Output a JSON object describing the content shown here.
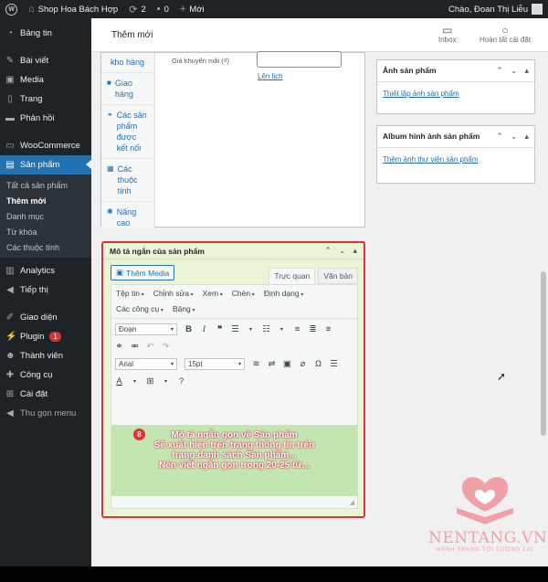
{
  "adminbar": {
    "site_name": "Shop Hoa Bách Hợp",
    "updates_count": "2",
    "comments_count": "0",
    "new_label": "Mới",
    "greeting": "Chào, Đoan Thị Liễu"
  },
  "sidebar": {
    "items": [
      {
        "label": "Bảng tin",
        "icon": "dashboard-icon"
      },
      {
        "label": "Bài viết",
        "icon": "pin-icon"
      },
      {
        "label": "Media",
        "icon": "media-icon"
      },
      {
        "label": "Trang",
        "icon": "page-icon"
      },
      {
        "label": "Phản hồi",
        "icon": "comment-icon"
      },
      {
        "label": "WooCommerce",
        "icon": "woocommerce-icon"
      },
      {
        "label": "Sản phẩm",
        "icon": "archive-icon"
      }
    ],
    "submenu": [
      "Tất cả sản phẩm",
      "Thêm mới",
      "Danh mục",
      "Từ khóa",
      "Các thuộc tính"
    ],
    "items2": [
      {
        "label": "Analytics",
        "icon": "chart-icon"
      },
      {
        "label": "Tiếp thị",
        "icon": "megaphone-icon"
      }
    ],
    "items3": [
      {
        "label": "Giao diện",
        "icon": "brush-icon"
      },
      {
        "label": "Plugin",
        "icon": "plugin-icon",
        "badge": "1"
      },
      {
        "label": "Thành viên",
        "icon": "users-icon"
      },
      {
        "label": "Công cụ",
        "icon": "wrench-icon"
      },
      {
        "label": "Cài đặt",
        "icon": "settings-icon"
      }
    ],
    "collapse": "Thu gọn menu"
  },
  "topbar": {
    "title": "Thêm mới",
    "inbox": "Inbox",
    "finish_setup": "Hoàn tất cài đặt"
  },
  "product_data": {
    "tabs": [
      "kho hàng",
      "Giao hàng",
      "Các sản phẩm được kết nối",
      "Các thuộc tính",
      "Nâng cao"
    ],
    "sale_price_label": "Giá khuyến mãi (₫)",
    "schedule_link": "Lên lịch"
  },
  "product_image": {
    "title": "Ảnh sản phẩm",
    "link": "Thiết lập ảnh sản phẩm"
  },
  "gallery": {
    "title": "Album hình ảnh sản phẩm",
    "link": "Thêm ảnh thư viện sản phẩm"
  },
  "short_description": {
    "title": "Mô tả ngắn của sản phẩm",
    "add_media": "Thêm Media",
    "tab_visual": "Trực quan",
    "tab_text": "Văn bản",
    "menus": [
      "Tệp tin",
      "Chỉnh sửa",
      "Xem",
      "Chèn",
      "Định dạng",
      "Các công cụ",
      "Bảng"
    ],
    "block_format": "Đoạn",
    "font_family": "Arial",
    "font_size": "15pt",
    "step_number": "8",
    "note_lines": [
      "Mô tả ngắn gọn về Sản phẩm",
      "Sẽ xuất hiện trên trang thông tin trên",
      "trang danh sách Sản phẩm...",
      "Nên viết ngắn gọn trong 20-25 từ..."
    ]
  },
  "watermark": {
    "brand": "NENTANG.VN",
    "tagline": "HÀNH TRANG TỚI TƯƠNG LAI"
  }
}
